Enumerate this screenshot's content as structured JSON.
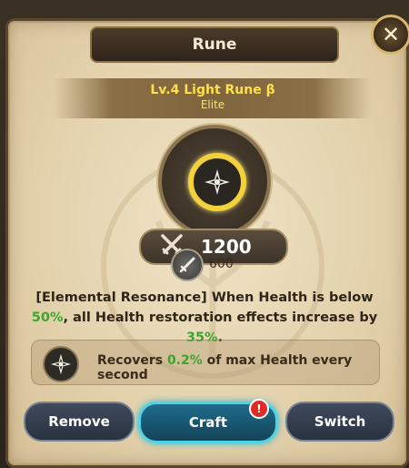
{
  "header": {
    "title": "Rune",
    "close_icon": "close-icon"
  },
  "rune": {
    "name": "Lv.4 Light Rune β",
    "grade": "Elite",
    "icon": "light-rune-icon"
  },
  "stats": {
    "power_value": "1200",
    "power_icon": "crossed-swords-icon",
    "attack_value": "600",
    "attack_icon": "sword-icon"
  },
  "effect": {
    "part1": "[Elemental Resonance] When Health is below ",
    "threshold": "50%",
    "part2": ", all Health restoration effects increase by ",
    "bonus": "35%",
    "part3": "."
  },
  "passive": {
    "icon": "light-rune-icon",
    "prefix": "Recovers ",
    "value": "0.2%",
    "suffix": " of max Health every second"
  },
  "buttons": {
    "remove_label": "Remove",
    "craft_label": "Craft",
    "switch_label": "Switch",
    "craft_alert": "!"
  },
  "colors": {
    "highlight_green": "#3da52e",
    "rune_gold": "#f2d13a",
    "craft_accent": "#4fd3e8"
  }
}
